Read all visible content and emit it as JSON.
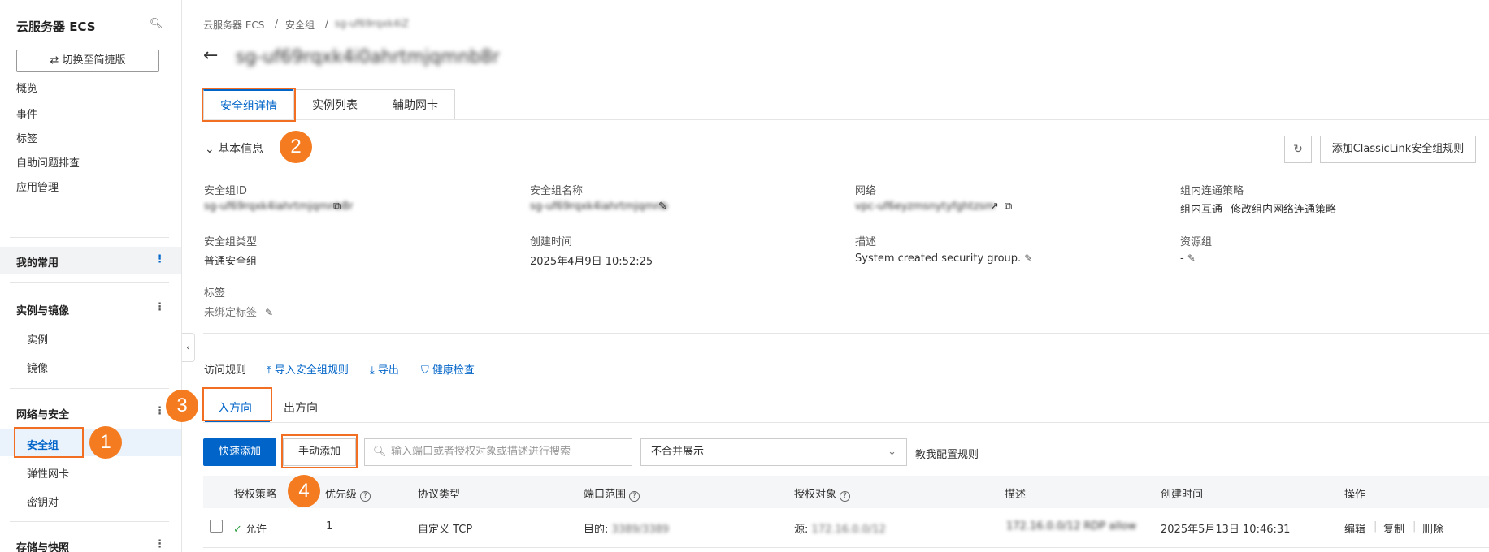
{
  "sidebar": {
    "title": "云服务器 ECS",
    "switch_label": "切换至简捷版",
    "items": [
      "概览",
      "事件",
      "标签",
      "自助问题排查",
      "应用管理"
    ],
    "my_common": "我的常用",
    "group_instances": "实例与镜像",
    "instances_items": [
      "实例",
      "镜像"
    ],
    "group_network": "网络与安全",
    "network_items": [
      "安全组",
      "弹性网卡",
      "密钥对"
    ],
    "group_storage": "存储与快照"
  },
  "breadcrumb": [
    "云服务器 ECS",
    "安全组",
    "sg-uf69rqxk4iZ"
  ],
  "header": {
    "back_icon": "arrow-left-icon",
    "resource_id": "sg-uf69rqxk4i0ahrtmjqmnb8r"
  },
  "tabs": [
    "安全组详情",
    "实例列表",
    "辅助网卡"
  ],
  "basic_info": {
    "title": "基本信息",
    "add_classiclink": "添加ClassicLink安全组规则",
    "fields": {
      "sg_id_label": "安全组ID",
      "sg_id": "sg-uf69rqxk4iahrtmjqmnb8r",
      "sg_name_label": "安全组名称",
      "sg_name": "sg-uf69rqxk4iahrtmjqmnb",
      "network_label": "网络",
      "network": "vpc-uf6eyzmsnytyfghtzsm",
      "policy_label": "组内连通策略",
      "policy": "组内互通",
      "policy_link": "修改组内网络连通策略",
      "type_label": "安全组类型",
      "type": "普通安全组",
      "created_label": "创建时间",
      "created": "2025年4月9日 10:52:25",
      "desc_label": "描述",
      "desc": "System created security group.",
      "rg_label": "资源组",
      "rg": "-",
      "tags_label": "标签",
      "tags": "未绑定标签"
    }
  },
  "rules": {
    "title": "访问规则",
    "import": "导入安全组规则",
    "export": "导出",
    "health": "健康检查",
    "inbound": "入方向",
    "outbound": "出方向",
    "quick_add": "快速添加",
    "manual_add": "手动添加",
    "search_placeholder": "输入端口或者授权对象或描述进行搜索",
    "merge_option": "不合并展示",
    "teach_link": "教我配置规则",
    "columns": [
      "授权策略",
      "优先级",
      "协议类型",
      "端口范围",
      "授权对象",
      "描述",
      "创建时间",
      "操作"
    ],
    "row": {
      "policy": "允许",
      "priority": "1",
      "protocol": "自定义 TCP",
      "port_prefix": "目的:",
      "port": "3389/3389",
      "source_prefix": "源:",
      "source": "172.16.0.0/12",
      "desc": "172.16.0.0/12 RDP allow",
      "created": "2025年5月13日 10:46:31",
      "actions": [
        "编辑",
        "复制",
        "删除"
      ]
    }
  },
  "annotations": [
    "1",
    "2",
    "3",
    "4"
  ]
}
